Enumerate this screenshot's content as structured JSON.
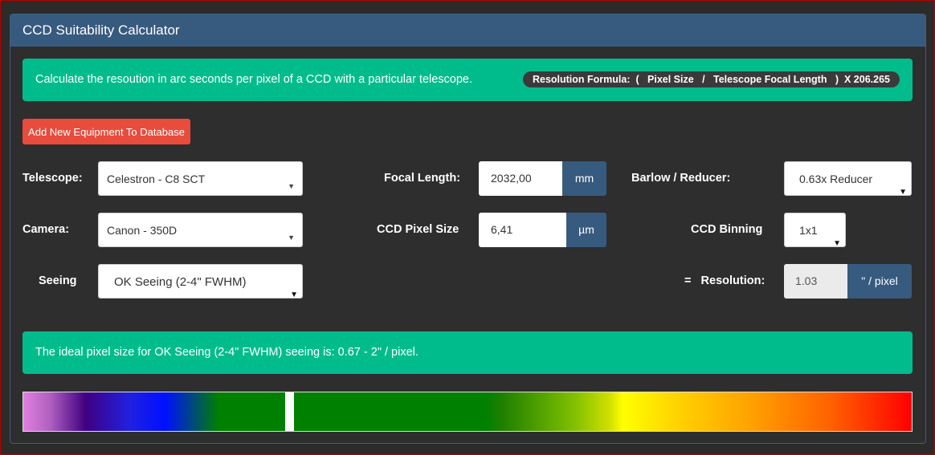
{
  "panel": {
    "title": "CCD Suitability Calculator"
  },
  "info": {
    "description": "Calculate the resoution in arc seconds per pixel of a CCD with a particular telescope.",
    "formula": "Resolution Formula:  (   Pixel Size   /   Telescope Focal Length   )  X 206.265"
  },
  "buttons": {
    "add_equipment": "Add New Equipment To Database"
  },
  "telescope": {
    "label": "Telescope:",
    "value": "Celestron - C8 SCT"
  },
  "camera": {
    "label": "Camera:",
    "value": "Canon - 350D"
  },
  "seeing": {
    "label": "Seeing",
    "value": "OK Seeing (2-4\" FWHM)"
  },
  "focal_length": {
    "label": "Focal Length:",
    "value": "2032,00",
    "unit": "mm"
  },
  "pixel_size": {
    "label": "CCD Pixel Size",
    "value": "6,41",
    "unit": "µm"
  },
  "barlow": {
    "label": "Barlow / Reducer:",
    "value": "0.63x Reducer"
  },
  "binning": {
    "label": "CCD Binning",
    "value": "1x1"
  },
  "resolution": {
    "label": "=   Resolution:",
    "value": "1.03",
    "unit": "\" / pixel"
  },
  "result": {
    "message": "The ideal pixel size for OK Seeing (2-4\" FWHM) seeing is: 0.67 - 2\" / pixel."
  },
  "colors": {
    "accent": "#00bc8c",
    "header": "#375a7f",
    "danger": "#e74c3c"
  },
  "icons": {
    "caret": "caret-down-icon"
  }
}
